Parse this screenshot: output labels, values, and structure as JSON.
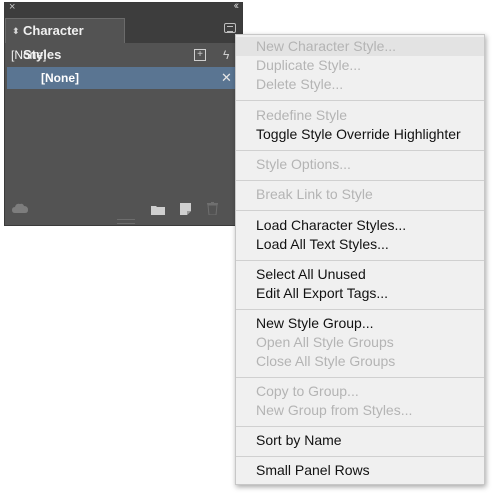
{
  "panel": {
    "close_glyph": "×",
    "collapse_glyph": "‹‹",
    "tab_label": "Character Styles",
    "top_style_label": "[None]",
    "selected_style_label": "[None]"
  },
  "menu": {
    "items": [
      {
        "label": "New Character Style...",
        "enabled": false,
        "highlighted": true
      },
      {
        "label": "Duplicate Style...",
        "enabled": false
      },
      {
        "label": "Delete Style...",
        "enabled": false
      },
      {
        "label": "Redefine Style",
        "enabled": false
      },
      {
        "label": "Toggle Style Override Highlighter",
        "enabled": true
      },
      {
        "label": "Style Options...",
        "enabled": false
      },
      {
        "label": "Break Link to Style",
        "enabled": false
      },
      {
        "label": "Load Character Styles...",
        "enabled": true
      },
      {
        "label": "Load All Text Styles...",
        "enabled": true
      },
      {
        "label": "Select All Unused",
        "enabled": true
      },
      {
        "label": "Edit All Export Tags...",
        "enabled": true
      },
      {
        "label": "New Style Group...",
        "enabled": true
      },
      {
        "label": "Open All Style Groups",
        "enabled": false
      },
      {
        "label": "Close All Style Groups",
        "enabled": false
      },
      {
        "label": "Copy to Group...",
        "enabled": false
      },
      {
        "label": "New Group from Styles...",
        "enabled": false
      },
      {
        "label": "Sort by Name",
        "enabled": true
      },
      {
        "label": "Small Panel Rows",
        "enabled": true
      }
    ]
  },
  "icons": {
    "panel_menu": "panel-menu-icon",
    "new_style": "new-style-icon",
    "quick_apply": "lightning-icon",
    "style_tools": "tools-icon",
    "cloud_library": "cloud-icon",
    "new_group": "folder-icon",
    "create_style": "new-page-icon",
    "delete": "trash-icon"
  },
  "colors": {
    "panel_bg": "#535353",
    "selection": "#5a7592",
    "menu_bg": "#f0f0f0",
    "menu_highlight": "#e3e3e3",
    "disabled_text": "#b4b4b4"
  }
}
